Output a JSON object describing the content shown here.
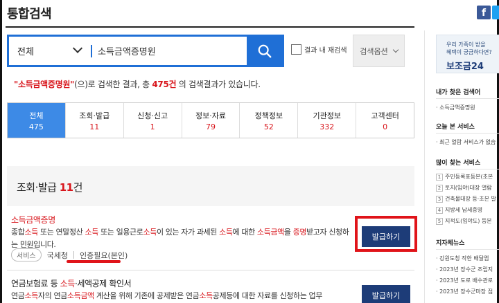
{
  "header": {
    "title": "통합검색",
    "social_fb": "f"
  },
  "search": {
    "scope": "전체",
    "query": "소득금액증명원",
    "re_search_label": "결과 내 재검색",
    "options_label": "검색옵션"
  },
  "summary": {
    "keyword": "\"소득금액증명원\"",
    "text_a": "(으)로 검색한 결과, 총 ",
    "count": "475",
    "count_unit": "건",
    "text_b": " 의 검색결과가 있습니다."
  },
  "tabs": [
    {
      "label": "전체",
      "count": "475",
      "active": true
    },
    {
      "label": "조회·발급",
      "count": "11"
    },
    {
      "label": "신청·신고",
      "count": "1"
    },
    {
      "label": "정보·자료",
      "count": "79"
    },
    {
      "label": "정책정보",
      "count": "52"
    },
    {
      "label": "기관정보",
      "count": "332"
    },
    {
      "label": "고객센터",
      "count": "0"
    }
  ],
  "section": {
    "title": "조회·발급",
    "count": "11",
    "unit": "건"
  },
  "results": [
    {
      "title": "소득금액증명",
      "desc_parts": [
        "종합",
        "소득",
        " 또는 연말정산 ",
        "소득",
        " 또는 일용근로",
        "소득",
        "이 있는 자가 과세된 ",
        "소득",
        "에 대한 ",
        "소득금액",
        "을 ",
        "증명",
        "받고자 신청하는 민원입니다."
      ],
      "badge": "서비스",
      "agency": "국세청",
      "auth": "인증필요(본인)",
      "button": "발급하기"
    },
    {
      "title_a": "연금보험료 등 ",
      "title_b": "소득",
      "title_c": "·세액공제 확인서",
      "desc_parts": [
        "연금",
        "소득",
        "자의 연금",
        "소득금액",
        " 계산을 위해 기존에 공제받은 연금",
        "소득",
        "공제등에 대한 자료를 신청하는 업무"
      ],
      "button": "발급하기"
    }
  ],
  "sidebar": {
    "banner_line1": "우리 가족이 받을",
    "banner_line2": "혜택이 궁금하다면?",
    "banner_brand": "보조금24",
    "my_searches_title": "내가 찾은 검색어",
    "my_searches": [
      "· 소득금액증명원"
    ],
    "today_title": "오늘 본 서비스",
    "today_items": [
      "· 최근 열람 서비스가 없습"
    ],
    "popular_title": "많이 찾는 서비스",
    "popular": [
      {
        "n": "1",
        "t": "주민등록표등본(초본"
      },
      {
        "n": "2",
        "t": "토지(임야)대장 열람"
      },
      {
        "n": "3",
        "t": "건축물대장 등·초본 발"
      },
      {
        "n": "4",
        "t": "지방세 납세증명"
      },
      {
        "n": "5",
        "t": "지적도(임야도) 등본"
      }
    ],
    "news_title": "지자체뉴스",
    "news": [
      "· 강원도청 작한 배달앱",
      "· 2023년 장수군 조립지",
      "· 2023년 도로 배수관로",
      "· 2023년 장수군마장 점"
    ]
  },
  "colors": {
    "accent_blue": "#1f6fd6",
    "tab_active": "#3d8ae6",
    "button_navy": "#1d3c78",
    "highlight_red": "#e0141a",
    "keyword_red": "#d8161c"
  }
}
